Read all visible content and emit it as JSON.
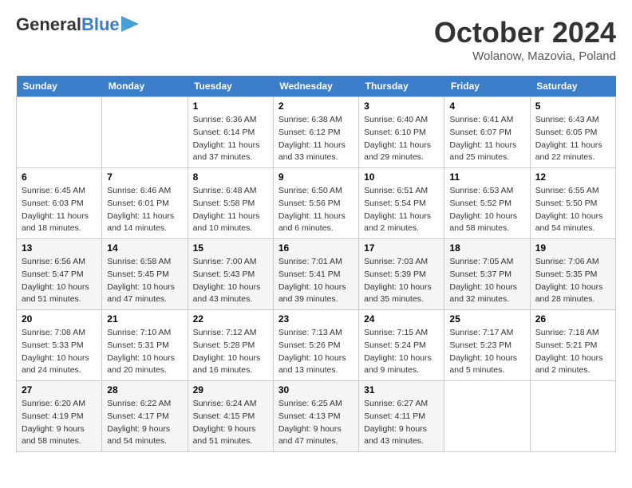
{
  "header": {
    "logo_general": "General",
    "logo_blue": "Blue",
    "month_title": "October 2024",
    "location": "Wolanow, Mazovia, Poland"
  },
  "days_of_week": [
    "Sunday",
    "Monday",
    "Tuesday",
    "Wednesday",
    "Thursday",
    "Friday",
    "Saturday"
  ],
  "weeks": [
    [
      {
        "day": "",
        "sunrise": "",
        "sunset": "",
        "daylight": ""
      },
      {
        "day": "",
        "sunrise": "",
        "sunset": "",
        "daylight": ""
      },
      {
        "day": "1",
        "sunrise": "Sunrise: 6:36 AM",
        "sunset": "Sunset: 6:14 PM",
        "daylight": "Daylight: 11 hours and 37 minutes."
      },
      {
        "day": "2",
        "sunrise": "Sunrise: 6:38 AM",
        "sunset": "Sunset: 6:12 PM",
        "daylight": "Daylight: 11 hours and 33 minutes."
      },
      {
        "day": "3",
        "sunrise": "Sunrise: 6:40 AM",
        "sunset": "Sunset: 6:10 PM",
        "daylight": "Daylight: 11 hours and 29 minutes."
      },
      {
        "day": "4",
        "sunrise": "Sunrise: 6:41 AM",
        "sunset": "Sunset: 6:07 PM",
        "daylight": "Daylight: 11 hours and 25 minutes."
      },
      {
        "day": "5",
        "sunrise": "Sunrise: 6:43 AM",
        "sunset": "Sunset: 6:05 PM",
        "daylight": "Daylight: 11 hours and 22 minutes."
      }
    ],
    [
      {
        "day": "6",
        "sunrise": "Sunrise: 6:45 AM",
        "sunset": "Sunset: 6:03 PM",
        "daylight": "Daylight: 11 hours and 18 minutes."
      },
      {
        "day": "7",
        "sunrise": "Sunrise: 6:46 AM",
        "sunset": "Sunset: 6:01 PM",
        "daylight": "Daylight: 11 hours and 14 minutes."
      },
      {
        "day": "8",
        "sunrise": "Sunrise: 6:48 AM",
        "sunset": "Sunset: 5:58 PM",
        "daylight": "Daylight: 11 hours and 10 minutes."
      },
      {
        "day": "9",
        "sunrise": "Sunrise: 6:50 AM",
        "sunset": "Sunset: 5:56 PM",
        "daylight": "Daylight: 11 hours and 6 minutes."
      },
      {
        "day": "10",
        "sunrise": "Sunrise: 6:51 AM",
        "sunset": "Sunset: 5:54 PM",
        "daylight": "Daylight: 11 hours and 2 minutes."
      },
      {
        "day": "11",
        "sunrise": "Sunrise: 6:53 AM",
        "sunset": "Sunset: 5:52 PM",
        "daylight": "Daylight: 10 hours and 58 minutes."
      },
      {
        "day": "12",
        "sunrise": "Sunrise: 6:55 AM",
        "sunset": "Sunset: 5:50 PM",
        "daylight": "Daylight: 10 hours and 54 minutes."
      }
    ],
    [
      {
        "day": "13",
        "sunrise": "Sunrise: 6:56 AM",
        "sunset": "Sunset: 5:47 PM",
        "daylight": "Daylight: 10 hours and 51 minutes."
      },
      {
        "day": "14",
        "sunrise": "Sunrise: 6:58 AM",
        "sunset": "Sunset: 5:45 PM",
        "daylight": "Daylight: 10 hours and 47 minutes."
      },
      {
        "day": "15",
        "sunrise": "Sunrise: 7:00 AM",
        "sunset": "Sunset: 5:43 PM",
        "daylight": "Daylight: 10 hours and 43 minutes."
      },
      {
        "day": "16",
        "sunrise": "Sunrise: 7:01 AM",
        "sunset": "Sunset: 5:41 PM",
        "daylight": "Daylight: 10 hours and 39 minutes."
      },
      {
        "day": "17",
        "sunrise": "Sunrise: 7:03 AM",
        "sunset": "Sunset: 5:39 PM",
        "daylight": "Daylight: 10 hours and 35 minutes."
      },
      {
        "day": "18",
        "sunrise": "Sunrise: 7:05 AM",
        "sunset": "Sunset: 5:37 PM",
        "daylight": "Daylight: 10 hours and 32 minutes."
      },
      {
        "day": "19",
        "sunrise": "Sunrise: 7:06 AM",
        "sunset": "Sunset: 5:35 PM",
        "daylight": "Daylight: 10 hours and 28 minutes."
      }
    ],
    [
      {
        "day": "20",
        "sunrise": "Sunrise: 7:08 AM",
        "sunset": "Sunset: 5:33 PM",
        "daylight": "Daylight: 10 hours and 24 minutes."
      },
      {
        "day": "21",
        "sunrise": "Sunrise: 7:10 AM",
        "sunset": "Sunset: 5:31 PM",
        "daylight": "Daylight: 10 hours and 20 minutes."
      },
      {
        "day": "22",
        "sunrise": "Sunrise: 7:12 AM",
        "sunset": "Sunset: 5:28 PM",
        "daylight": "Daylight: 10 hours and 16 minutes."
      },
      {
        "day": "23",
        "sunrise": "Sunrise: 7:13 AM",
        "sunset": "Sunset: 5:26 PM",
        "daylight": "Daylight: 10 hours and 13 minutes."
      },
      {
        "day": "24",
        "sunrise": "Sunrise: 7:15 AM",
        "sunset": "Sunset: 5:24 PM",
        "daylight": "Daylight: 10 hours and 9 minutes."
      },
      {
        "day": "25",
        "sunrise": "Sunrise: 7:17 AM",
        "sunset": "Sunset: 5:23 PM",
        "daylight": "Daylight: 10 hours and 5 minutes."
      },
      {
        "day": "26",
        "sunrise": "Sunrise: 7:18 AM",
        "sunset": "Sunset: 5:21 PM",
        "daylight": "Daylight: 10 hours and 2 minutes."
      }
    ],
    [
      {
        "day": "27",
        "sunrise": "Sunrise: 6:20 AM",
        "sunset": "Sunset: 4:19 PM",
        "daylight": "Daylight: 9 hours and 58 minutes."
      },
      {
        "day": "28",
        "sunrise": "Sunrise: 6:22 AM",
        "sunset": "Sunset: 4:17 PM",
        "daylight": "Daylight: 9 hours and 54 minutes."
      },
      {
        "day": "29",
        "sunrise": "Sunrise: 6:24 AM",
        "sunset": "Sunset: 4:15 PM",
        "daylight": "Daylight: 9 hours and 51 minutes."
      },
      {
        "day": "30",
        "sunrise": "Sunrise: 6:25 AM",
        "sunset": "Sunset: 4:13 PM",
        "daylight": "Daylight: 9 hours and 47 minutes."
      },
      {
        "day": "31",
        "sunrise": "Sunrise: 6:27 AM",
        "sunset": "Sunset: 4:11 PM",
        "daylight": "Daylight: 9 hours and 43 minutes."
      },
      {
        "day": "",
        "sunrise": "",
        "sunset": "",
        "daylight": ""
      },
      {
        "day": "",
        "sunrise": "",
        "sunset": "",
        "daylight": ""
      }
    ]
  ]
}
